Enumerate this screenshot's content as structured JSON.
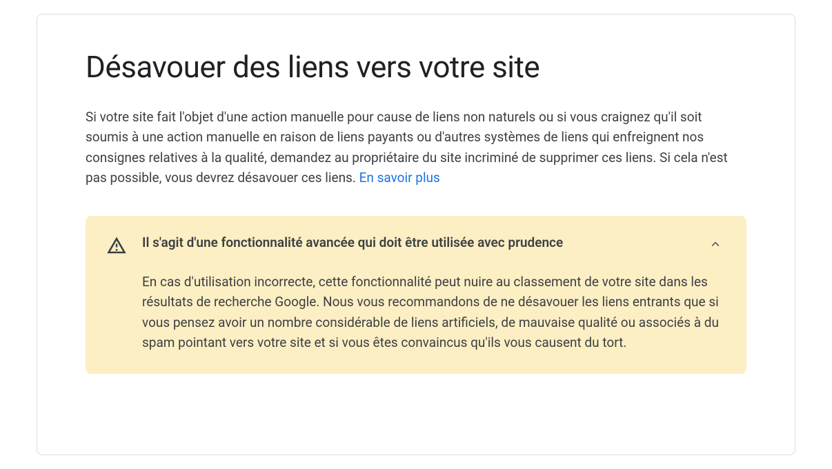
{
  "page": {
    "title": "Désavouer des liens vers votre site",
    "intro": "Si votre site fait l'objet d'une action manuelle pour cause de liens non naturels ou si vous craignez qu'il soit soumis à une action manuelle en raison de liens payants ou d'autres systèmes de liens qui enfreignent nos consignes relatives à la qualité, demandez au propriétaire du site incriminé de supprimer ces liens. Si cela n'est pas possible, vous devrez désavouer ces liens. ",
    "learn_more_label": "En savoir plus"
  },
  "warning": {
    "title": "Il s'agit d'une fonctionnalité avancée qui doit être utilisée avec prudence",
    "body": "En cas d'utilisation incorrecte, cette fonctionnalité peut nuire au classement de votre site dans les résultats de recherche Google. Nous vous recommandons de ne désavouer les liens entrants que si vous pensez avoir un nombre considérable de liens artificiels, de mauvaise qualité ou associés à du spam pointant vers votre site et si vous êtes convaincus qu'ils vous causent du tort.",
    "expanded": true
  },
  "colors": {
    "link": "#1a73e8",
    "warning_bg": "#fdefc4",
    "text": "#3c4043",
    "heading": "#202124"
  }
}
